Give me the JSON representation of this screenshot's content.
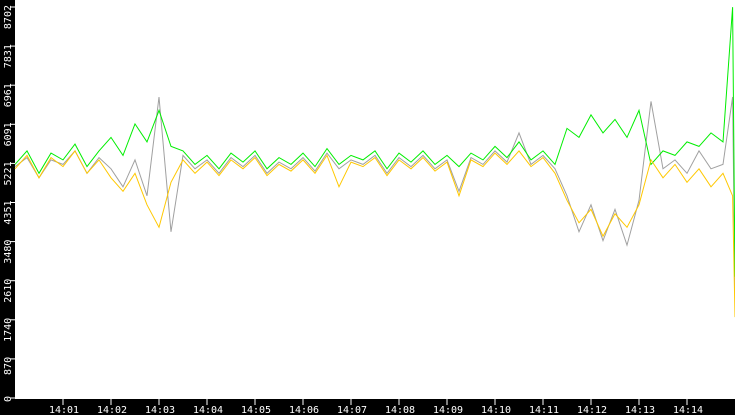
{
  "chart_data": {
    "type": "line",
    "title": "",
    "xlabel": "",
    "ylabel": "",
    "xlim_minutes_after_14_00": [
      0,
      15
    ],
    "ylim": [
      0,
      8702
    ],
    "y_ticks": [
      "0",
      "870",
      "1740",
      "2610",
      "3480",
      "4351",
      "5221",
      "6091",
      "6961",
      "7831",
      "8702"
    ],
    "x_ticks": [
      "14:01",
      "14:02",
      "14:03",
      "14:04",
      "14:05",
      "14:06",
      "14:07",
      "14:08",
      "14:09",
      "14:10",
      "14:11",
      "14:12",
      "14:13",
      "14:14"
    ],
    "x": [
      0,
      0.25,
      0.5,
      0.75,
      1,
      1.25,
      1.5,
      1.75,
      2,
      2.25,
      2.5,
      2.75,
      3,
      3.25,
      3.5,
      3.75,
      4,
      4.25,
      4.5,
      4.75,
      5,
      5.25,
      5.5,
      5.75,
      6,
      6.25,
      6.5,
      6.75,
      7,
      7.25,
      7.5,
      7.75,
      8,
      8.25,
      8.5,
      8.75,
      9,
      9.25,
      9.5,
      9.75,
      10,
      10.25,
      10.5,
      10.75,
      11,
      11.25,
      11.5,
      11.75,
      12,
      12.25,
      12.5,
      12.75,
      13,
      13.25,
      13.5,
      13.75,
      14,
      14.25,
      14.5,
      14.75,
      14.95,
      15
    ],
    "series": [
      {
        "name": "gray",
        "color": "#a0a0a0",
        "values": [
          5150,
          5350,
          4900,
          5300,
          5200,
          5500,
          5000,
          5350,
          5100,
          4700,
          5300,
          4500,
          6700,
          3700,
          5400,
          5100,
          5300,
          5000,
          5350,
          5150,
          5400,
          5000,
          5250,
          5100,
          5350,
          5050,
          5450,
          5100,
          5300,
          5200,
          5400,
          5000,
          5350,
          5150,
          5400,
          5100,
          5300,
          4600,
          5350,
          5200,
          5500,
          5250,
          5900,
          5200,
          5400,
          5100,
          4500,
          3700,
          4300,
          3500,
          4200,
          3400,
          4400,
          6600,
          5100,
          5300,
          5000,
          5500,
          5100,
          5200,
          6700,
          2300
        ]
      },
      {
        "name": "green",
        "color": "#00ee00",
        "values": [
          5200,
          5500,
          5000,
          5450,
          5300,
          5650,
          5150,
          5500,
          5800,
          5400,
          6100,
          5700,
          6400,
          5600,
          5500,
          5200,
          5400,
          5100,
          5450,
          5250,
          5500,
          5100,
          5350,
          5200,
          5450,
          5150,
          5550,
          5200,
          5400,
          5300,
          5500,
          5100,
          5450,
          5250,
          5500,
          5200,
          5400,
          5150,
          5450,
          5300,
          5600,
          5350,
          5700,
          5300,
          5500,
          5200,
          6000,
          5800,
          6300,
          5900,
          6200,
          5800,
          6400,
          5200,
          5500,
          5400,
          5700,
          5600,
          5900,
          5700,
          8700,
          2700
        ]
      },
      {
        "name": "yellow",
        "color": "#ffc800",
        "values": [
          5100,
          5400,
          4900,
          5350,
          5150,
          5500,
          5000,
          5300,
          4900,
          4600,
          5000,
          4300,
          3800,
          4800,
          5300,
          5000,
          5250,
          4950,
          5300,
          5100,
          5350,
          4950,
          5200,
          5050,
          5300,
          5000,
          5400,
          4700,
          5250,
          5150,
          5350,
          4950,
          5300,
          5100,
          5350,
          5050,
          5250,
          4500,
          5300,
          5150,
          5450,
          5200,
          5500,
          5150,
          5350,
          5000,
          4400,
          3900,
          4200,
          3600,
          4100,
          3800,
          4300,
          5300,
          4900,
          5200,
          4800,
          5100,
          4700,
          5000,
          4500,
          1800
        ]
      }
    ],
    "legend": "none",
    "grid": false
  }
}
